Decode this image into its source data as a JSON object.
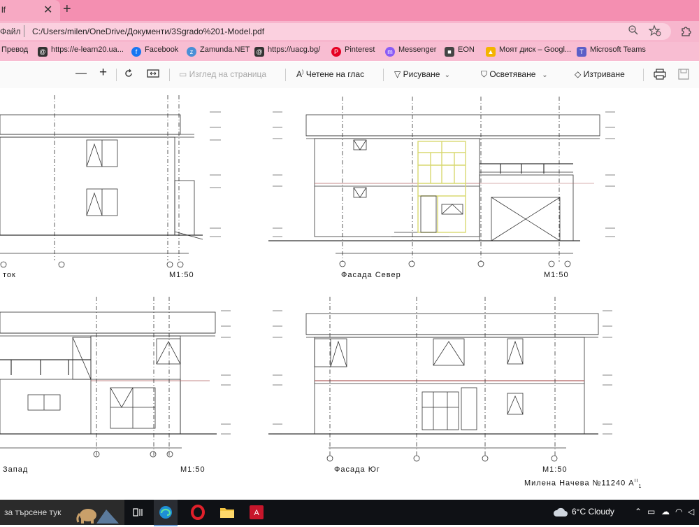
{
  "tab": {
    "title": "lf",
    "close": "✕",
    "new": "+"
  },
  "address": {
    "prefix": "Файл",
    "url": "C:/Users/milen/OneDrive/Документи/3Sgrado%201-Model.pdf"
  },
  "bookmarks": [
    {
      "label": "Превод",
      "icon": "translate-icon"
    },
    {
      "label": "https://e-learn20.ua...",
      "icon": "page-icon"
    },
    {
      "label": "Facebook",
      "icon": "facebook-icon"
    },
    {
      "label": "Zamunda.NET",
      "icon": "zamunda-icon"
    },
    {
      "label": "https://uacg.bg/",
      "icon": "page-icon"
    },
    {
      "label": "Pinterest",
      "icon": "pinterest-icon"
    },
    {
      "label": "Messenger",
      "icon": "messenger-icon"
    },
    {
      "label": "EON",
      "icon": "eon-icon"
    },
    {
      "label": "Моят диск – Googl...",
      "icon": "drive-icon"
    },
    {
      "label": "Microsoft Teams",
      "icon": "teams-icon"
    }
  ],
  "toolbar": {
    "page_view": "Изглед на страница",
    "read_aloud": "Четене на глас",
    "draw": "Рисуване",
    "highlight": "Осветяване",
    "erase": "Изтриване"
  },
  "drawing": {
    "views": [
      {
        "title": "ток",
        "scale": "M1:50"
      },
      {
        "title": "Фасада Север",
        "scale": "M1:50"
      },
      {
        "title": "Запад",
        "scale": "M1:50"
      },
      {
        "title": "Фасада Юг",
        "scale": "M1:50"
      }
    ],
    "signature": "Милена Начева   №11240  A",
    "signature_sup": "II",
    "signature_sub": "1"
  },
  "taskbar": {
    "search": "за търсене тук",
    "weather": "6°C  Cloudy"
  },
  "colors": {
    "tabbar": "#f48fb1",
    "addressbar": "#f7b6cd",
    "bookmarks": "#f8bdd2",
    "highlight": "#d8d870",
    "taskbar": "#0f1115"
  }
}
